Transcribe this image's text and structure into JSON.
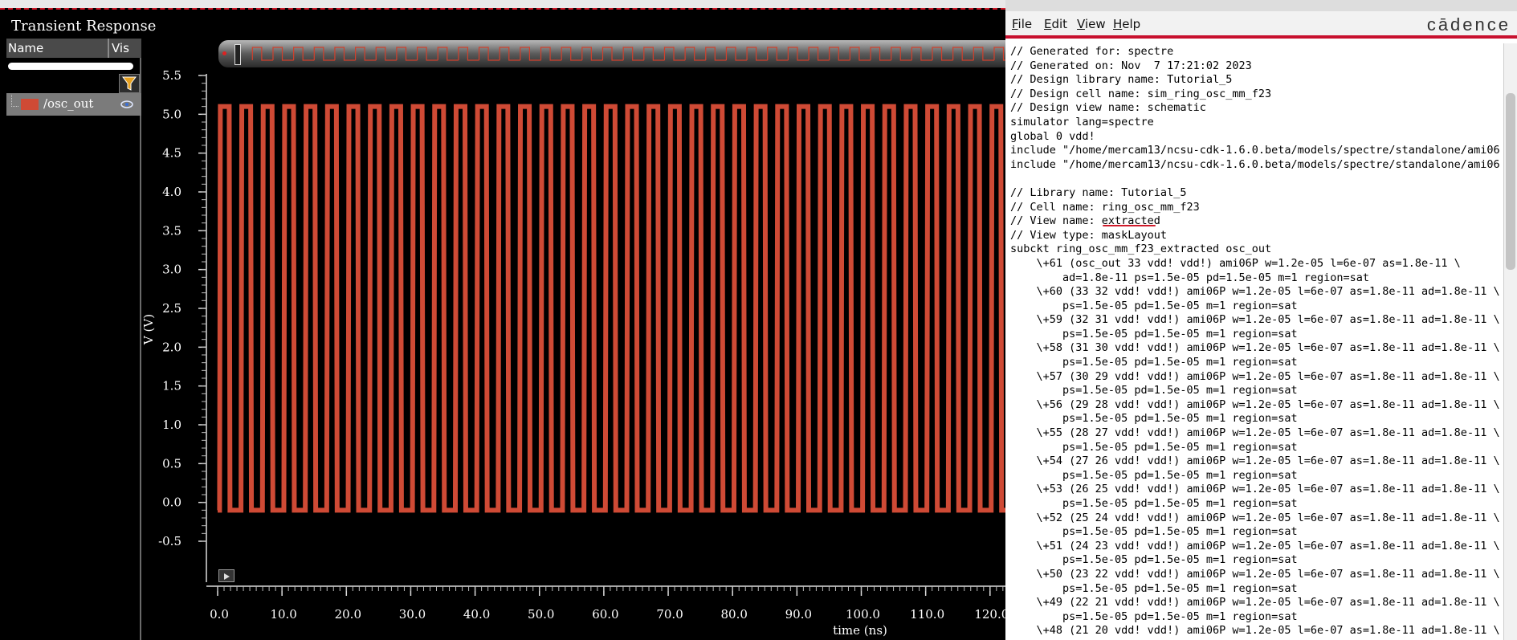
{
  "waveform_window": {
    "title": "Transient Response",
    "signal_table": {
      "col_name": "Name",
      "col_vis": "Vis",
      "signal": {
        "name": "/osc_out",
        "color": "#cf4a35"
      }
    },
    "icons": {
      "filter": "filter-icon",
      "eye": "eye-icon",
      "play": "play-icon"
    }
  },
  "chart_data": {
    "type": "line",
    "xlabel": "time (ns)",
    "ylabel": "V (V)",
    "xlim": [
      0,
      122
    ],
    "ylim": [
      -0.5,
      5.5
    ],
    "x_ticks": [
      "0.0",
      "10.0",
      "20.0",
      "30.0",
      "40.0",
      "50.0",
      "60.0",
      "70.0",
      "80.0",
      "90.0",
      "100.0",
      "110.0",
      "120.0"
    ],
    "x_tick_values": [
      0,
      10,
      20,
      30,
      40,
      50,
      60,
      70,
      80,
      90,
      100,
      110,
      120
    ],
    "y_ticks": [
      "-0.5",
      "0.0",
      "0.5",
      "1.0",
      "1.5",
      "2.0",
      "2.5",
      "3.0",
      "3.5",
      "4.0",
      "4.5",
      "5.0",
      "5.5"
    ],
    "y_tick_values": [
      -0.5,
      0,
      0.5,
      1,
      1.5,
      2,
      2.5,
      3,
      3.5,
      4,
      4.5,
      5,
      5.5
    ],
    "series": [
      {
        "name": "/osc_out",
        "color": "#cf4a35",
        "start_ns": 0.3,
        "period_ns": 3.33,
        "high_v": 5.1,
        "low_v": -0.1,
        "duty": 0.45
      }
    ]
  },
  "netlist_window": {
    "menu": [
      {
        "u": "F",
        "rest": "ile"
      },
      {
        "u": "E",
        "rest": "dit"
      },
      {
        "u": "V",
        "rest": "iew"
      },
      {
        "u": "H",
        "rest": "elp"
      }
    ],
    "brand": "cādence",
    "lines": [
      "// Generated for: spectre",
      "// Generated on: Nov  7 17:21:02 2023",
      "// Design library name: Tutorial_5",
      "// Design cell name: sim_ring_osc_mm_f23",
      "// Design view name: schematic",
      "simulator lang=spectre",
      "global 0 vdd!",
      "include \"/home/mercam13/ncsu-cdk-1.6.0.beta/models/spectre/standalone/ami06",
      "include \"/home/mercam13/ncsu-cdk-1.6.0.beta/models/spectre/standalone/ami06",
      "",
      "// Library name: Tutorial_5",
      "// Cell name: ring_osc_mm_f23",
      "// View name: extracted",
      "// View type: maskLayout",
      "subckt ring_osc_mm_f23_extracted osc_out",
      "    \\+61 (osc_out 33 vdd! vdd!) ami06P w=1.2e-05 l=6e-07 as=1.8e-11 \\",
      "        ad=1.8e-11 ps=1.5e-05 pd=1.5e-05 m=1 region=sat",
      "    \\+60 (33 32 vdd! vdd!) ami06P w=1.2e-05 l=6e-07 as=1.8e-11 ad=1.8e-11 \\",
      "        ps=1.5e-05 pd=1.5e-05 m=1 region=sat",
      "    \\+59 (32 31 vdd! vdd!) ami06P w=1.2e-05 l=6e-07 as=1.8e-11 ad=1.8e-11 \\",
      "        ps=1.5e-05 pd=1.5e-05 m=1 region=sat",
      "    \\+58 (31 30 vdd! vdd!) ami06P w=1.2e-05 l=6e-07 as=1.8e-11 ad=1.8e-11 \\",
      "        ps=1.5e-05 pd=1.5e-05 m=1 region=sat",
      "    \\+57 (30 29 vdd! vdd!) ami06P w=1.2e-05 l=6e-07 as=1.8e-11 ad=1.8e-11 \\",
      "        ps=1.5e-05 pd=1.5e-05 m=1 region=sat",
      "    \\+56 (29 28 vdd! vdd!) ami06P w=1.2e-05 l=6e-07 as=1.8e-11 ad=1.8e-11 \\",
      "        ps=1.5e-05 pd=1.5e-05 m=1 region=sat",
      "    \\+55 (28 27 vdd! vdd!) ami06P w=1.2e-05 l=6e-07 as=1.8e-11 ad=1.8e-11 \\",
      "        ps=1.5e-05 pd=1.5e-05 m=1 region=sat",
      "    \\+54 (27 26 vdd! vdd!) ami06P w=1.2e-05 l=6e-07 as=1.8e-11 ad=1.8e-11 \\",
      "        ps=1.5e-05 pd=1.5e-05 m=1 region=sat",
      "    \\+53 (26 25 vdd! vdd!) ami06P w=1.2e-05 l=6e-07 as=1.8e-11 ad=1.8e-11 \\",
      "        ps=1.5e-05 pd=1.5e-05 m=1 region=sat",
      "    \\+52 (25 24 vdd! vdd!) ami06P w=1.2e-05 l=6e-07 as=1.8e-11 ad=1.8e-11 \\",
      "        ps=1.5e-05 pd=1.5e-05 m=1 region=sat",
      "    \\+51 (24 23 vdd! vdd!) ami06P w=1.2e-05 l=6e-07 as=1.8e-11 ad=1.8e-11 \\",
      "        ps=1.5e-05 pd=1.5e-05 m=1 region=sat",
      "    \\+50 (23 22 vdd! vdd!) ami06P w=1.2e-05 l=6e-07 as=1.8e-11 ad=1.8e-11 \\",
      "        ps=1.5e-05 pd=1.5e-05 m=1 region=sat",
      "    \\+49 (22 21 vdd! vdd!) ami06P w=1.2e-05 l=6e-07 as=1.8e-11 ad=1.8e-11 \\",
      "        ps=1.5e-05 pd=1.5e-05 m=1 region=sat",
      "    \\+48 (21 20 vdd! vdd!) ami06P w=1.2e-05 l=6e-07 as=1.8e-11 ad=1.8e-11 \\"
    ]
  }
}
